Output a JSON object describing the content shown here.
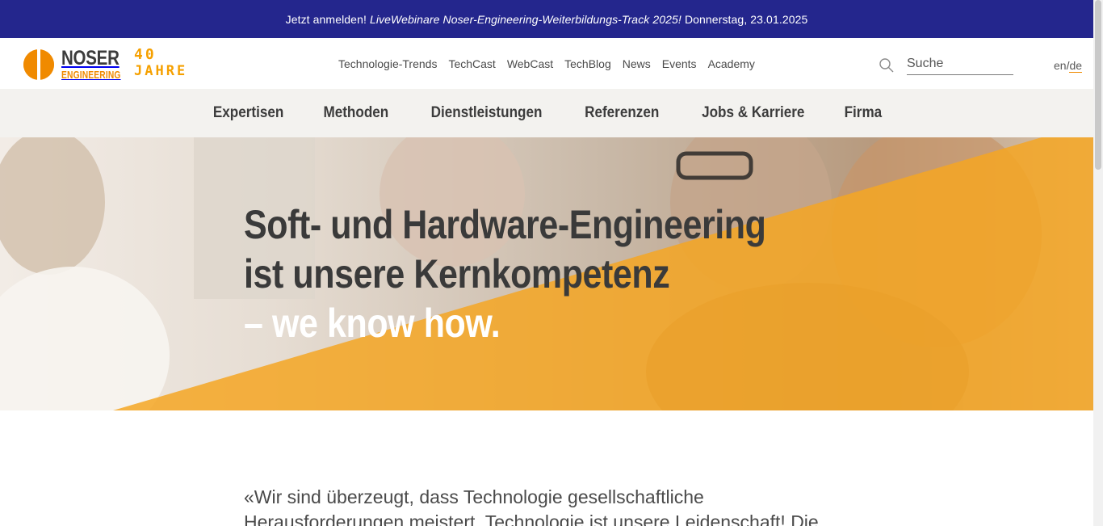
{
  "announcement": {
    "prefix": "Jetzt anmelden!",
    "title": "LiveWebinare Noser-Engineering-Weiterbildungs-Track 2025!",
    "date": "Donnerstag, 23.01.2025",
    "background": "#24268d"
  },
  "logo": {
    "brand": "NOSER",
    "sub": "ENGINEERING",
    "anniversary_line1": "40",
    "anniversary_line2": "JAHRE",
    "accent": "#f08a00",
    "icon": "noser-logo-icon"
  },
  "topnav": {
    "items": [
      "Technologie-Trends",
      "TechCast",
      "WebCast",
      "TechBlog",
      "News",
      "Events",
      "Academy"
    ]
  },
  "search": {
    "placeholder": "Suche",
    "icon": "search-icon"
  },
  "language": {
    "en": "en",
    "separator": "/",
    "de": "de",
    "active": "de"
  },
  "mainnav": {
    "items": [
      "Expertisen",
      "Methoden",
      "Dienstleistungen",
      "Referenzen",
      "Jobs & Karriere",
      "Firma"
    ]
  },
  "hero": {
    "line1": "Soft- und Hardware-Engineering",
    "line2": "ist unsere Kernkompetenz",
    "line3": "– we know how.",
    "overlay_color": "#f5a623"
  },
  "intro": {
    "text": "«Wir sind überzeugt, dass Technologie gesellschaftliche Herausforderungen meistert. Technologie ist unsere Leidenschaft! Die"
  }
}
